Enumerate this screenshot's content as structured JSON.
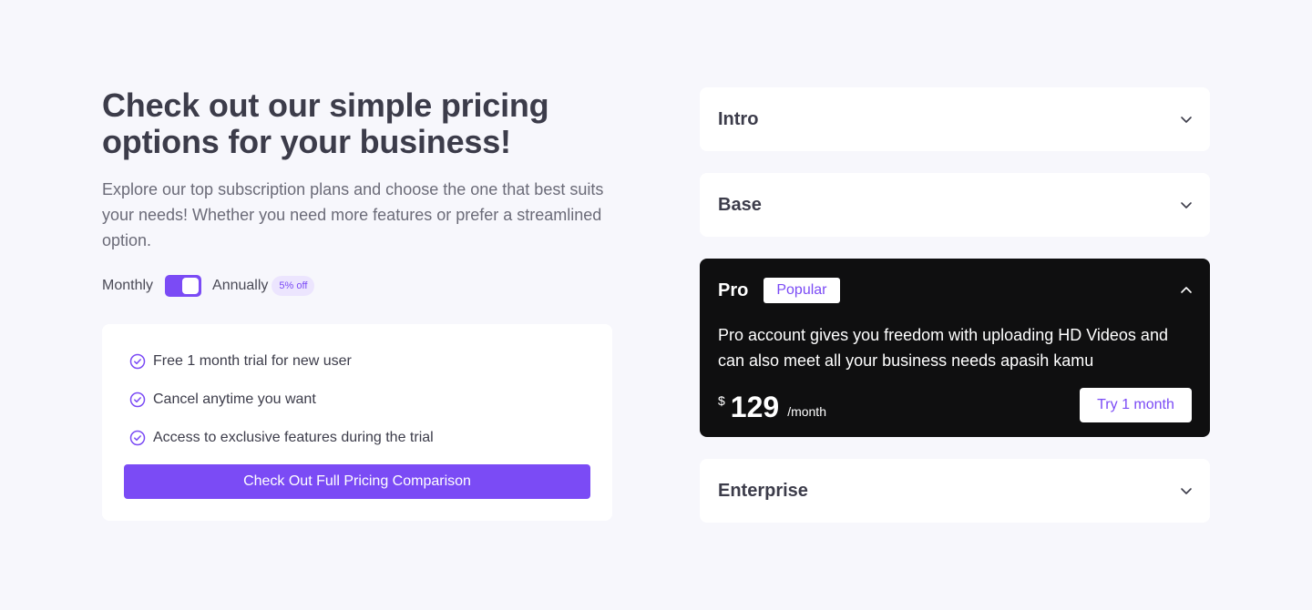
{
  "hero": {
    "title": "Check out our simple pricing options for your business!",
    "subtitle": "Explore our top subscription plans and choose the one that best suits your needs! Whether you need more features or prefer a streamlined option."
  },
  "billing": {
    "monthly_label": "Monthly",
    "annually_label": "Annually",
    "discount_badge": "5% off",
    "toggle_on": true
  },
  "benefits": {
    "items": [
      "Free 1 month trial for new user",
      "Cancel anytime you want",
      "Access to exclusive features during the trial"
    ],
    "cta_label": "Check Out Full Pricing Comparison",
    "icon": "check-circle-icon"
  },
  "plans": [
    {
      "name": "Intro",
      "expanded": false,
      "icon": "chevron-down-icon"
    },
    {
      "name": "Base",
      "expanded": false,
      "icon": "chevron-down-icon"
    },
    {
      "name": "Pro",
      "expanded": true,
      "badge": "Popular",
      "description": "Pro account gives you freedom with uploading HD Videos and can also meet all your business needs apasih kamu",
      "currency": "$",
      "price": "129",
      "period": "/month",
      "cta_label": "Try 1 month",
      "icon": "chevron-up-icon"
    },
    {
      "name": "Enterprise",
      "expanded": false,
      "icon": "chevron-down-icon"
    }
  ],
  "colors": {
    "accent": "#7b4bf5",
    "background": "#f7f7fc",
    "pro_card": "#0f0f10",
    "heading": "#3c3c4a"
  }
}
